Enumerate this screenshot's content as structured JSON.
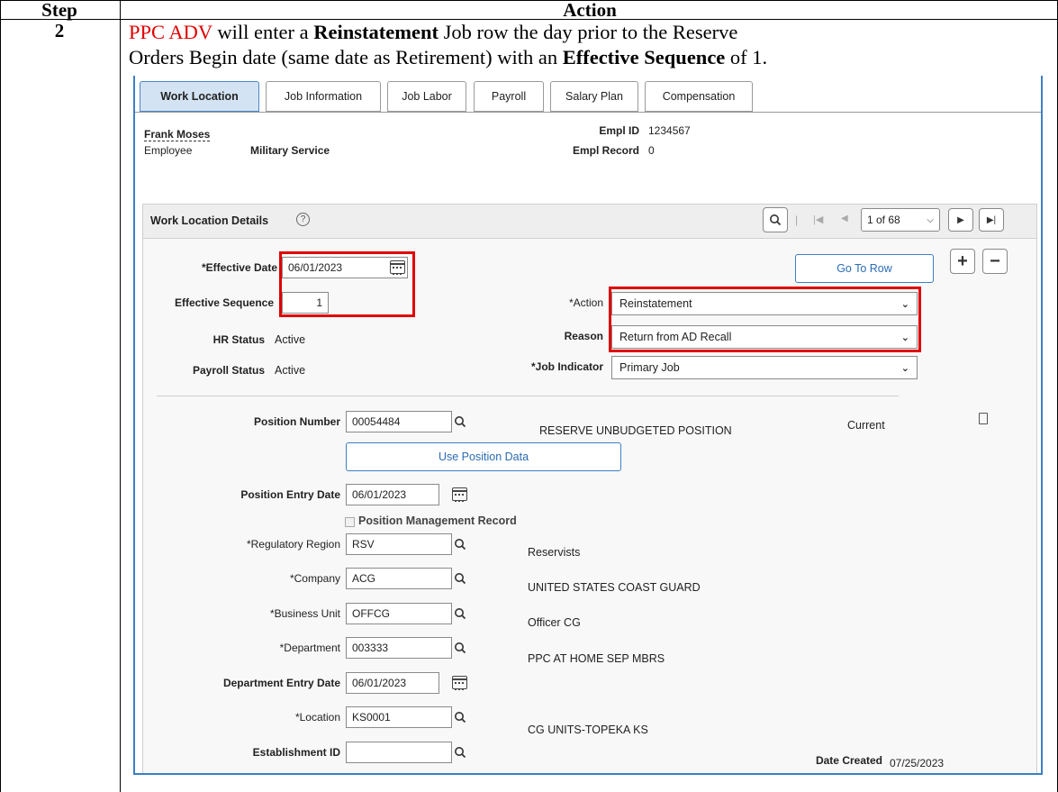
{
  "doc": {
    "header_step": "Step",
    "header_action": "Action",
    "step_number": "2",
    "instruction": {
      "part1": "PPC ADV",
      "part2": " will enter a ",
      "part3": "Reinstatement",
      "part4": " Job row the day prior to the Reserve",
      "line2a": "Orders Begin date (same date as Retirement) with an ",
      "line2b": "Effective Sequence",
      "line2c": " of 1."
    }
  },
  "tabs": [
    {
      "label": "Work Location",
      "active": true
    },
    {
      "label": "Job Information",
      "active": false
    },
    {
      "label": "Job Labor",
      "active": false
    },
    {
      "label": "Payroll",
      "active": false
    },
    {
      "label": "Salary Plan",
      "active": false
    },
    {
      "label": "Compensation",
      "active": false
    }
  ],
  "employee": {
    "name": "Frank Moses",
    "type": "Employee",
    "category": "Military Service",
    "empl_id_label": "Empl ID",
    "empl_id": "1234567",
    "empl_record_label": "Empl Record",
    "empl_record": "0"
  },
  "section": {
    "title": "Work Location Details",
    "pager": "1 of 68"
  },
  "form": {
    "effective_date_label": "*Effective Date",
    "effective_date": "06/01/2023",
    "effective_seq_label": "Effective Sequence",
    "effective_seq": "1",
    "hr_status_label": "HR Status",
    "hr_status": "Active",
    "payroll_status_label": "Payroll Status",
    "payroll_status": "Active",
    "go_to_row": "Go To Row",
    "action_label": "*Action",
    "action": "Reinstatement",
    "reason_label": "Reason",
    "reason": "Return from AD Recall",
    "job_indicator_label": "*Job Indicator",
    "job_indicator": "Primary Job",
    "position_number_label": "Position Number",
    "position_number": "00054484",
    "position_desc": "RESERVE UNBUDGETED POSITION",
    "current": "Current",
    "use_position_data": "Use Position Data",
    "position_entry_date_label": "Position Entry Date",
    "position_entry_date": "06/01/2023",
    "position_mgmt_record": "Position Management Record",
    "reg_region_label": "*Regulatory Region",
    "reg_region": "RSV",
    "reg_region_desc": "Reservists",
    "company_label": "*Company",
    "company": "ACG",
    "company_desc": "UNITED STATES COAST GUARD",
    "business_unit_label": "*Business Unit",
    "business_unit": "OFFCG",
    "business_unit_desc": "Officer CG",
    "department_label": "*Department",
    "department": "003333",
    "department_desc": "PPC AT HOME SEP MBRS",
    "dept_entry_date_label": "Department Entry Date",
    "dept_entry_date": "06/01/2023",
    "location_label": "*Location",
    "location": "KS0001",
    "location_desc": "CG UNITS-TOPEKA KS",
    "establishment_label": "Establishment ID",
    "establishment": "",
    "date_created_label": "Date Created",
    "date_created": "07/25/2023"
  }
}
